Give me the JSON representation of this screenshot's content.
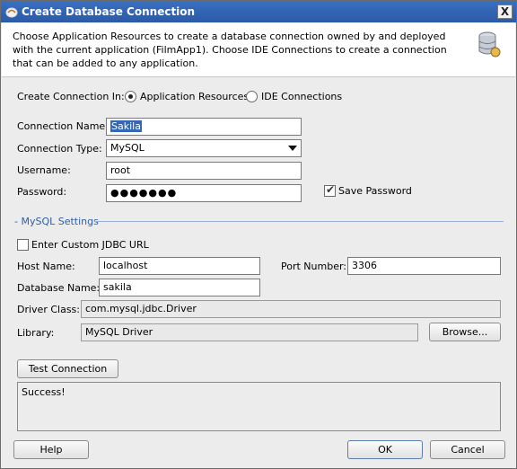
{
  "window": {
    "title": "Create Database Connection",
    "close_label": "X"
  },
  "header": {
    "description": "Choose Application Resources to create a database connection owned by and deployed with the current application (FilmApp1). Choose IDE Connections to create a connection that can be added to any application."
  },
  "create_in": {
    "label": "Create Connection In:",
    "options": [
      {
        "label": "Application Resources",
        "selected": true
      },
      {
        "label": "IDE Connections",
        "selected": false
      }
    ]
  },
  "connection": {
    "name_label": "Connection Name:",
    "name_value": "Sakila",
    "type_label": "Connection Type:",
    "type_value": "MySQL",
    "username_label": "Username:",
    "username_value": "root",
    "password_label": "Password:",
    "password_value": "●●●●●●●",
    "save_password_label": "Save Password",
    "save_password_checked": true
  },
  "mysql_settings": {
    "title": "- MySQL Settings",
    "custom_jdbc_label": "Enter Custom JDBC URL",
    "custom_jdbc_checked": false,
    "host_label": "Host Name:",
    "host_value": "localhost",
    "port_label": "Port Number:",
    "port_value": "3306",
    "database_label": "Database Name:",
    "database_value": "sakila",
    "driver_label": "Driver Class:",
    "driver_value": "com.mysql.jdbc.Driver",
    "library_label": "Library:",
    "library_value": "MySQL Driver",
    "browse_label": "Browse..."
  },
  "test": {
    "button_label": "Test Connection",
    "result_text": "Success!"
  },
  "footer": {
    "help_label": "Help",
    "ok_label": "OK",
    "cancel_label": "Cancel"
  }
}
